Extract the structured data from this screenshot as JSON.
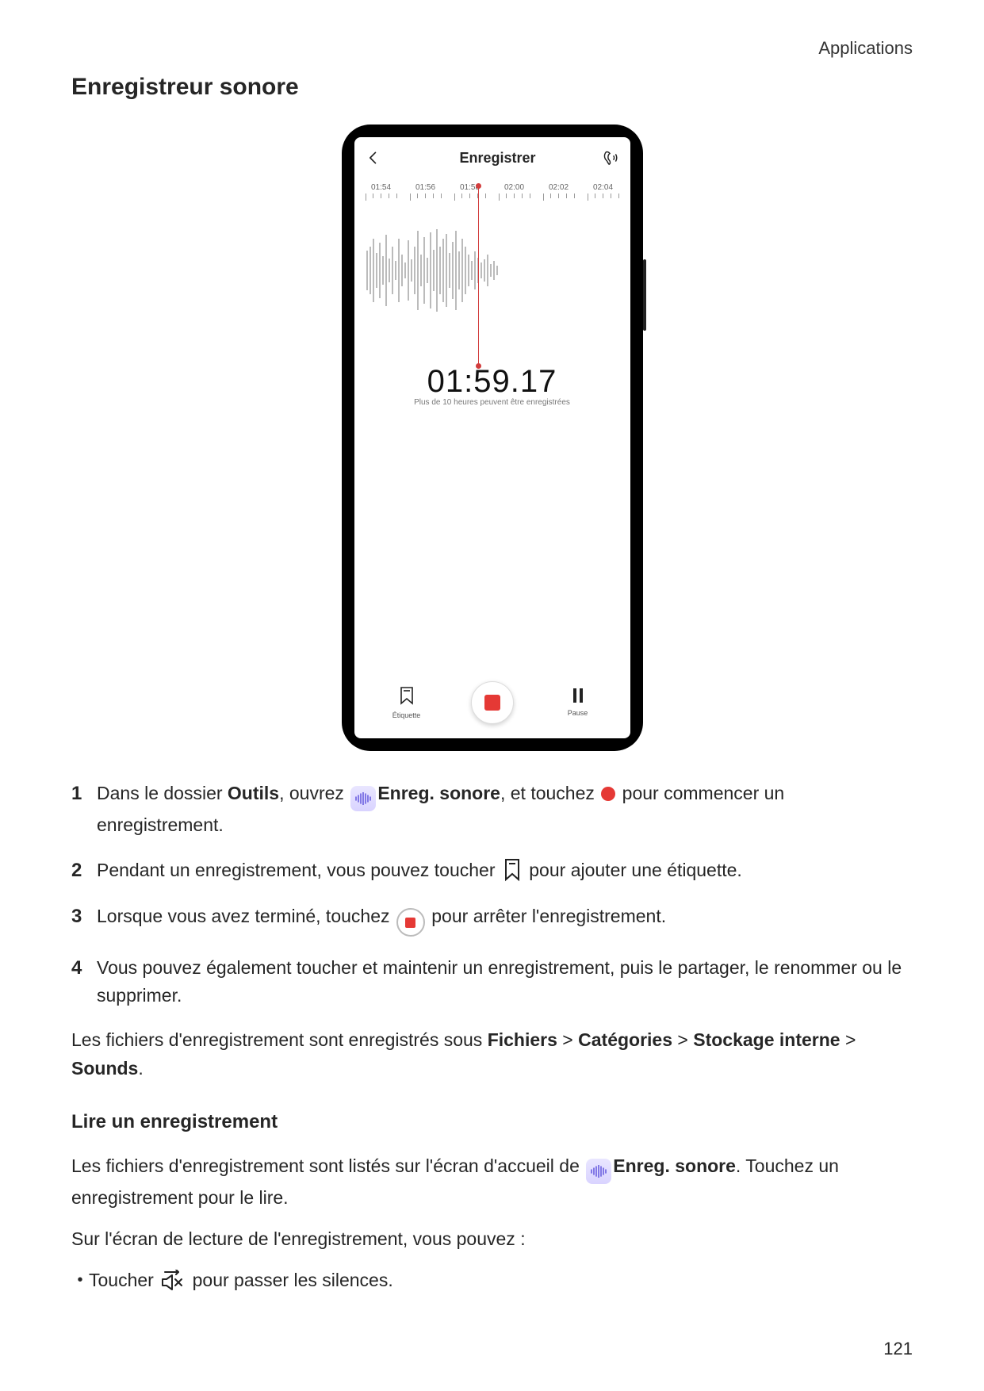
{
  "header": {
    "section": "Applications"
  },
  "title": "Enregistreur sonore",
  "phone": {
    "titlebar": {
      "title": "Enregistrer"
    },
    "ticks": [
      "01:54",
      "01:56",
      "01:58",
      "02:00",
      "02:02",
      "02:04"
    ],
    "timer": "01:59.17",
    "timer_sub": "Plus de 10 heures peuvent être enregistrées",
    "bottom": {
      "tag": "Étiquette",
      "pause": "Pause"
    }
  },
  "steps": [
    {
      "n": "1",
      "t1": "Dans le dossier ",
      "b1": "Outils",
      "t2": ", ouvrez ",
      "app": true,
      "b2": "Enreg. sonore",
      "t3": ", et touchez ",
      "reddot": true,
      "t4": " pour commencer un enregistrement."
    },
    {
      "n": "2",
      "t1": "Pendant un enregistrement, vous pouvez toucher ",
      "bookmark": true,
      "t2": " pour ajouter une étiquette."
    },
    {
      "n": "3",
      "t1": "Lorsque vous avez terminé, touchez ",
      "stop": true,
      "t2": " pour arrêter l'enregistrement."
    },
    {
      "n": "4",
      "t1": "Vous pouvez également toucher et maintenir un enregistrement, puis le partager, le renommer ou le supprimer."
    }
  ],
  "storage": {
    "t1": "Les fichiers d'enregistrement sont enregistrés sous ",
    "p1": "Fichiers",
    "gt1": " > ",
    "p2": "Catégories",
    "gt2": " > ",
    "p3": "Stockage interne",
    "gt3": " > ",
    "p4": "Sounds",
    "end": "."
  },
  "subheading": "Lire un enregistrement",
  "play": {
    "t1": "Les fichiers d'enregistrement sont listés sur l'écran d'accueil de ",
    "app": true,
    "b1": "Enreg. sonore",
    "t2": ". Touchez un enregistrement pour le lire."
  },
  "play2": "Sur l'écran de lecture de l'enregistrement, vous pouvez :",
  "bullet1": {
    "t1": "Toucher ",
    "mute": true,
    "t2": " pour passer les silences."
  },
  "page_number": "121"
}
